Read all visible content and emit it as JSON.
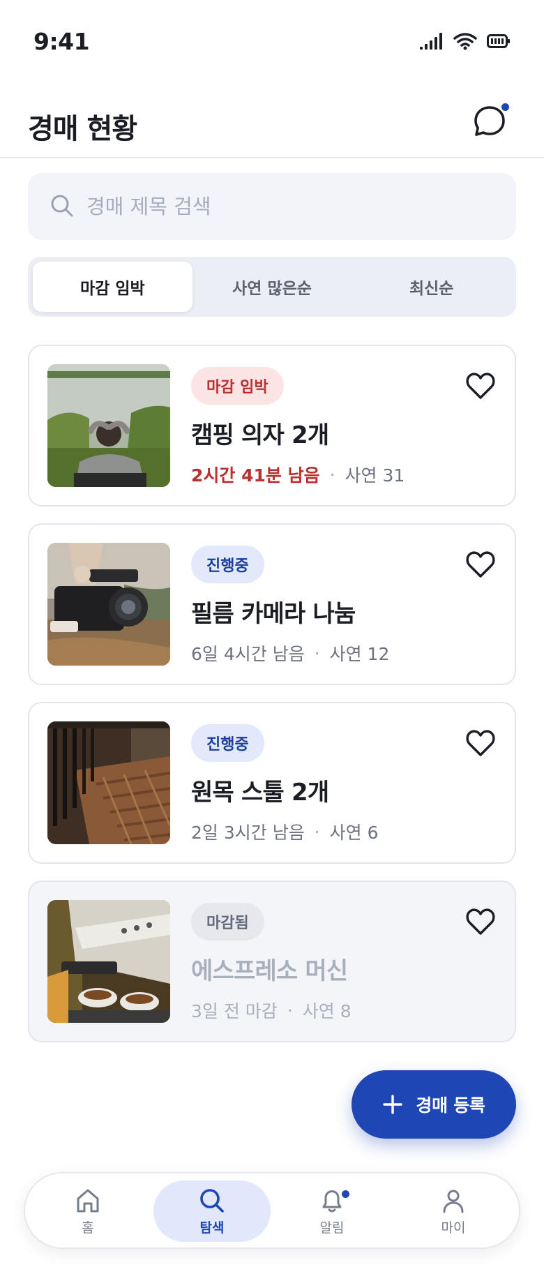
{
  "status_bar": {
    "time": "9:41"
  },
  "header": {
    "title": "경매 현황",
    "chat_icon": "chat-bubble-icon",
    "has_unread": true
  },
  "search": {
    "placeholder": "경매 제목 검색",
    "value": ""
  },
  "sort_tabs": [
    {
      "label": "마감 임박",
      "active": true
    },
    {
      "label": "사연 많은순",
      "active": false
    },
    {
      "label": "최신순",
      "active": false
    }
  ],
  "auctions": [
    {
      "badge": "마감 임박",
      "status": "urgent",
      "title": "캠핑 의자 2개",
      "time_left": "2시간 41분 남음",
      "stories": "사연 31",
      "image": "camping-photo"
    },
    {
      "badge": "진행중",
      "status": "ongoing",
      "title": "필름 카메라 나눔",
      "time_left": "6일 4시간 남음",
      "stories": "사연 12",
      "image": "camera-photo"
    },
    {
      "badge": "진행중",
      "status": "ongoing",
      "title": "원목 스툴 2개",
      "time_left": "2일 3시간 남음",
      "stories": "사연 6",
      "image": "stool-photo"
    },
    {
      "badge": "마감됨",
      "status": "ended",
      "title": "에스프레소 머신",
      "time_left": "3일 전 마감",
      "stories": "사연 8",
      "image": "espresso-photo"
    }
  ],
  "fab": {
    "label": "경매 등록"
  },
  "bottom_nav": [
    {
      "label": "홈",
      "icon": "home-icon",
      "active": false
    },
    {
      "label": "탐색",
      "icon": "search-icon",
      "active": true
    },
    {
      "label": "알림",
      "icon": "bell-icon",
      "active": false,
      "badge": true
    },
    {
      "label": "마이",
      "icon": "user-icon",
      "active": false
    }
  ],
  "colors": {
    "primary": "#1e46b4",
    "urgent": "#b8312f",
    "ongoing_bg": "#e2e9fb",
    "urgent_bg": "#fde4e4"
  }
}
